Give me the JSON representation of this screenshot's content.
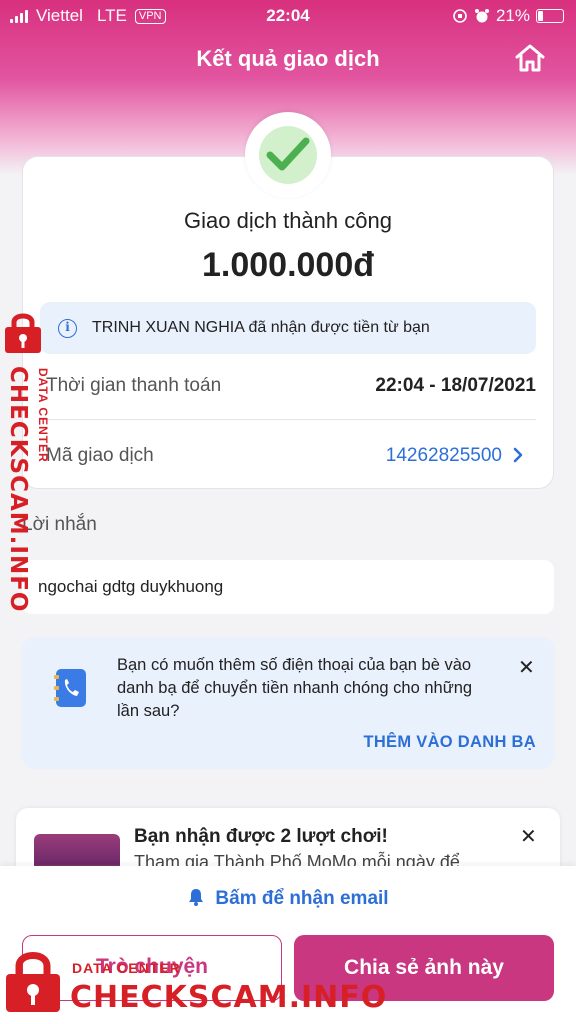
{
  "status_bar": {
    "carrier": "Viettel",
    "network": "LTE",
    "vpn": "VPN",
    "time": "22:04",
    "battery": "21%",
    "battery_level": 0.21
  },
  "header": {
    "title": "Kết quả giao dịch",
    "home_icon": "home-icon"
  },
  "transaction": {
    "status": "Giao dịch thành công",
    "amount": "1.000.000đ",
    "notice": "TRINH XUAN NGHIA đã nhận được tiền từ bạn",
    "time_label": "Thời gian thanh toán",
    "time_value": "22:04 - 18/07/2021",
    "id_label": "Mã giao dịch",
    "id_value": "14262825500"
  },
  "message": {
    "label": "Lời nhắn",
    "value": "ngochai gdtg duykhuong"
  },
  "contact_prompt": {
    "text": "Bạn có muốn thêm số điện thoại của bạn bè vào danh bạ để chuyển tiền nhanh chóng cho những lần sau?",
    "close": "✕",
    "action": "THÊM VÀO DANH BẠ"
  },
  "game_banner": {
    "title": "Bạn nhận được 2 lượt chơi!",
    "subtitle": "Tham gia Thành Phố MoMo mỗi ngày để",
    "close": "✕"
  },
  "footer": {
    "email": "Bấm để nhận email",
    "chat_button": "Trò chuyện",
    "share_button": "Chia sẻ ảnh này"
  },
  "watermark": {
    "site": "CHECKSCAM.INFO",
    "sub": "DATA CENTER"
  },
  "colors": {
    "brand": "#c8377f",
    "link": "#2d6fd6",
    "success": "#4caf50",
    "watermark": "#d71f26"
  }
}
